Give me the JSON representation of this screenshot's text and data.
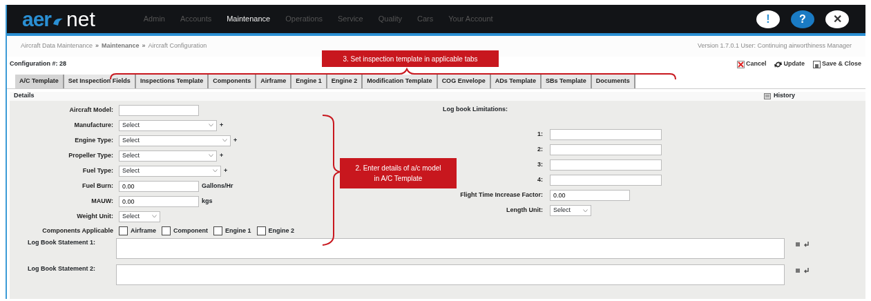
{
  "logo": {
    "part_1": "aer",
    "part_2": "net"
  },
  "menu": [
    {
      "label": "Admin",
      "selected": false
    },
    {
      "label": "Accounts",
      "selected": false
    },
    {
      "label": "Maintenance",
      "selected": true
    },
    {
      "label": "Operations",
      "selected": false
    },
    {
      "label": "Service",
      "selected": false
    },
    {
      "label": "Quality",
      "selected": false
    },
    {
      "label": "Cars",
      "selected": false
    },
    {
      "label": "Your Account",
      "selected": false
    }
  ],
  "header_buttons": [
    {
      "kind": "alert",
      "text": "!"
    },
    {
      "kind": "help",
      "text": "?"
    },
    {
      "kind": "close",
      "text": "✕"
    }
  ],
  "breadcrumb": {
    "separator": "»",
    "items": [
      "Aircraft Data Maintenance",
      "Maintenance",
      "Aircraft Configuration"
    ]
  },
  "version_text": "Version 1.7.0.1   User: Continuing airworthiness Manager",
  "configuration_label": "Configuration #: 28",
  "actions": [
    {
      "kind": "cancel",
      "label": "Cancel"
    },
    {
      "kind": "update",
      "label": "Update"
    },
    {
      "kind": "save",
      "label": "Save & Close"
    }
  ],
  "tabs": [
    {
      "label": "A/C Template",
      "selected": true
    },
    {
      "label": "Set Inspection Fields",
      "selected": false
    },
    {
      "label": "Inspections Template",
      "selected": false
    },
    {
      "label": "Components",
      "selected": false
    },
    {
      "label": "Airframe",
      "selected": false
    },
    {
      "label": "Engine 1",
      "selected": false
    },
    {
      "label": "Engine 2",
      "selected": false
    },
    {
      "label": "Modification Template",
      "selected": false
    },
    {
      "label": "COG Envelope",
      "selected": false
    },
    {
      "label": "ADs Template",
      "selected": false
    },
    {
      "label": "SBs Template",
      "selected": false
    },
    {
      "label": "Documents",
      "selected": false
    }
  ],
  "details": {
    "title": "Details",
    "history": "History"
  },
  "fields": [
    {
      "kind": "text",
      "label": "Aircraft Model:"
    },
    {
      "kind": "select",
      "label": "Manufacture:",
      "value": "Select",
      "add": "+"
    },
    {
      "kind": "select",
      "label": "Engine Type:",
      "value": "Select",
      "add": "+"
    },
    {
      "kind": "select",
      "label": "Propeller Type:",
      "value": "Select",
      "add": "+"
    },
    {
      "kind": "select",
      "label": "Fuel Type:",
      "value": "Select",
      "add": "+"
    },
    {
      "kind": "number",
      "label": "Fuel Burn:",
      "value": "0.00",
      "unit": "Gallons/Hr"
    },
    {
      "kind": "number",
      "label": "MAUW:",
      "value": "0.00",
      "unit": "kgs"
    },
    {
      "kind": "select",
      "label": "Weight Unit:",
      "value": "Select"
    }
  ],
  "components": {
    "label": "Components Applicable",
    "options": [
      {
        "label": "Airframe",
        "checked": false
      },
      {
        "label": "Component",
        "checked": false
      },
      {
        "label": "Engine 1",
        "checked": false
      },
      {
        "label": "Engine 2",
        "checked": false
      }
    ]
  },
  "limitations": {
    "title": "Log book Limitations:",
    "items": [
      "1:",
      "2:",
      "3:",
      "4:"
    ]
  },
  "flight_time": {
    "label": "Flight Time Increase Factor:",
    "value": "0.00"
  },
  "length_unit": {
    "label": "Length Unit:",
    "value": "Select"
  },
  "statements": [
    {
      "label": "Log Book Statement 1:"
    },
    {
      "label": "Log Book Statement 2:"
    }
  ],
  "annotations": [
    {
      "text": "3. Set inspection template in applicable tabs"
    },
    {
      "text": "2. Enter details of a/c model in A/C Template"
    }
  ]
}
